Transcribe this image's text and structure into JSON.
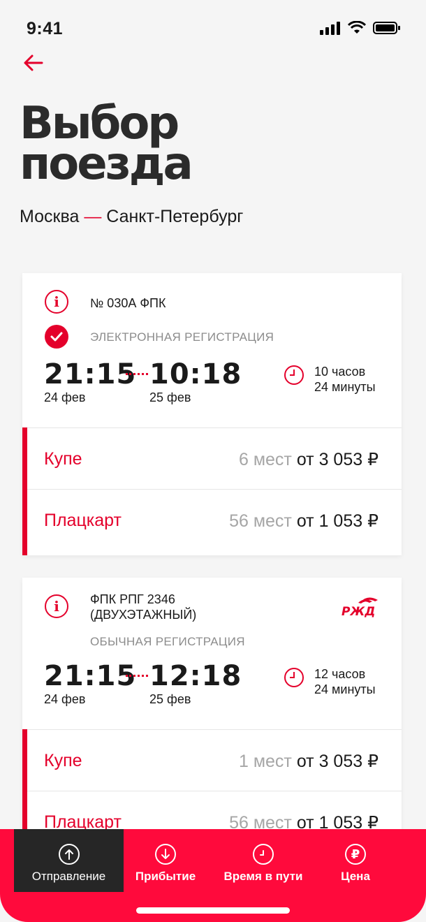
{
  "status": {
    "time": "9:41"
  },
  "header": {
    "title": "Выбор\nпоезда",
    "route_from": "Москва",
    "route_dash": "—",
    "route_to": "Санкт-Петербург"
  },
  "trains": [
    {
      "name": "№ 030А ФПК",
      "registration": "ЭЛЕКТРОННАЯ РЕГИСТРАЦИЯ",
      "depart_time": "21:15",
      "depart_date": "24 фев",
      "arrive_time": "10:18",
      "arrive_date": "25 фев",
      "duration_line1": "10 часов",
      "duration_line2": "24 минуты",
      "fares": [
        {
          "name": "Купе",
          "seats": "6 мест",
          "price": "от 3 053 ₽"
        },
        {
          "name": "Плацкарт",
          "seats": "56 мест",
          "price": "от 1 053 ₽"
        }
      ]
    },
    {
      "name": "ФПК РПГ 2346\n(ДВУХЭТАЖНЫЙ)",
      "registration": "ОБЫЧНАЯ РЕГИСТРАЦИЯ",
      "depart_time": "21:15",
      "depart_date": "24 фев",
      "arrive_time": "12:18",
      "arrive_date": "25 фев",
      "duration_line1": "12 часов",
      "duration_line2": "24 минуты",
      "fares": [
        {
          "name": "Купе",
          "seats": "1 мест",
          "price": "от 3 053 ₽"
        },
        {
          "name": "Плацкарт",
          "seats": "56 мест",
          "price": "от 1 053 ₽"
        }
      ]
    }
  ],
  "tabs": [
    {
      "label": "Отправление",
      "icon": "arrow-up-circle-icon"
    },
    {
      "label": "Прибытие",
      "icon": "arrow-down-circle-icon"
    },
    {
      "label": "Время в пути",
      "icon": "clock-icon"
    },
    {
      "label": "Цена",
      "icon": "ruble-icon"
    }
  ],
  "colors": {
    "accent": "#e4002b",
    "tabbar": "#ff0a3c",
    "active_tab": "#262626"
  }
}
